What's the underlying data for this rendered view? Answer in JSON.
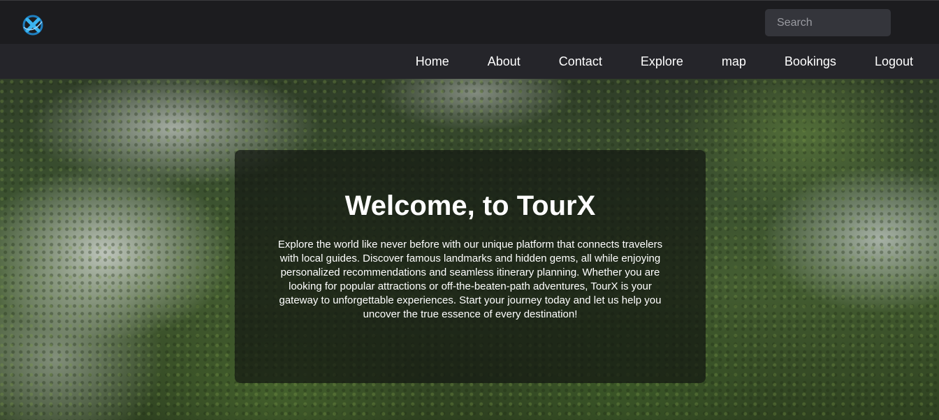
{
  "header": {
    "logo_icon": "tourx-logo-icon",
    "search": {
      "placeholder": "Search",
      "value": "",
      "icon": "search-icon"
    }
  },
  "nav": {
    "items": [
      {
        "label": "Home"
      },
      {
        "label": "About"
      },
      {
        "label": "Contact"
      },
      {
        "label": "Explore"
      },
      {
        "label": "map"
      },
      {
        "label": "Bookings"
      },
      {
        "label": "Logout"
      }
    ]
  },
  "hero": {
    "title": "Welcome, to TourX",
    "description": "Explore the world like never before with our unique platform that connects travelers with local guides. Discover famous landmarks and hidden gems, all while enjoying personalized recommendations and seamless itinerary planning. Whether you are looking for popular attractions or off-the-beaten-path adventures, TourX is your gateway to unforgettable experiences. Start your journey today and let us help you uncover the true essence of every destination!"
  },
  "colors": {
    "topbar": "#1c1c1f",
    "navbar": "#25252a",
    "search_bg": "#34353b",
    "logo_blue": "#2aa3e0"
  }
}
